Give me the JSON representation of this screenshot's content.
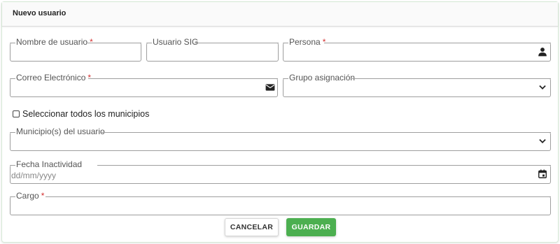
{
  "card": {
    "title": "Nuevo usuario"
  },
  "fields": {
    "nombre_usuario": {
      "label": "Nombre de usuario",
      "required": "*"
    },
    "usuario_sig": {
      "label": "Usuario SIG"
    },
    "persona": {
      "label": "Persona",
      "required": "*",
      "icon": "person-icon"
    },
    "correo": {
      "label": "Correo Electrónico",
      "required": "*",
      "icon": "envelope-icon"
    },
    "grupo": {
      "label": "Grupo asignación",
      "icon": "chevron-down-icon"
    },
    "municipios": {
      "label": "Municipio(s) del usuario",
      "icon": "chevron-down-icon"
    },
    "fecha": {
      "label": "Fecha Inactividad",
      "placeholder": "dd/mm/yyyy",
      "icon": "calendar-icon"
    },
    "cargo": {
      "label": "Cargo",
      "required": "*"
    }
  },
  "checkbox": {
    "label": "Seleccionar todos los municipios",
    "checked": false
  },
  "buttons": {
    "cancel": "CANCELAR",
    "save": "GUARDAR"
  },
  "colors": {
    "save_button": "#4caf50",
    "required_mark": "#d32f2f",
    "field_border": "#9e9e9e"
  }
}
